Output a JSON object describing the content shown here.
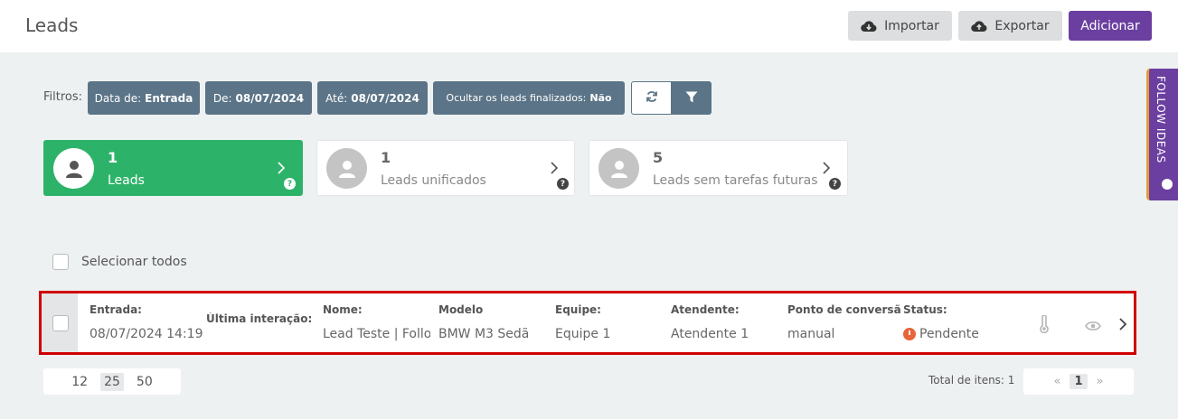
{
  "header": {
    "title": "Leads",
    "import_label": "Importar",
    "export_label": "Exportar",
    "add_label": "Adicionar"
  },
  "filters": {
    "label": "Filtros:",
    "chips": [
      {
        "key": "Data de:",
        "value": "Entrada"
      },
      {
        "key": "De:",
        "value": "08/07/2024"
      },
      {
        "key": "Até:",
        "value": "08/07/2024"
      },
      {
        "key": "Ocultar os leads finalizados:",
        "value": "Não"
      }
    ]
  },
  "cards": [
    {
      "count": "1",
      "label": "Leads",
      "active": true
    },
    {
      "count": "1",
      "label": "Leads unificados",
      "active": false
    },
    {
      "count": "5",
      "label": "Leads sem tarefas futuras",
      "active": false
    }
  ],
  "help_glyph": "?",
  "side_tab": "FOLLOW IDEAS",
  "select_all_label": "Selecionar todos",
  "lead": {
    "columns": [
      {
        "header": "Entrada:",
        "value": "08/07/2024 14:19"
      },
      {
        "header": "Última interação:",
        "value": ""
      },
      {
        "header": "Nome:",
        "value": "Lead Teste | Follow"
      },
      {
        "header": "Modelo",
        "value": "BMW M3 Sedã"
      },
      {
        "header": "Equipe:",
        "value": "Equipe 1"
      },
      {
        "header": "Atendente:",
        "value": "Atendente 1"
      },
      {
        "header": "Ponto de conversão:",
        "value": "manual"
      },
      {
        "header": "Status:",
        "value": "Pendente"
      }
    ],
    "status_color": "#e8643a"
  },
  "pagination": {
    "page_sizes": [
      "12",
      "25",
      "50"
    ],
    "selected_size": "25",
    "total_label": "Total de itens: 1",
    "prev": "«",
    "current_page": "1",
    "next": "»"
  },
  "colors": {
    "accent_purple": "#6b3fa0",
    "chip_bg": "#5b7487",
    "active_card": "#2db369",
    "highlight_border": "#d00000"
  }
}
